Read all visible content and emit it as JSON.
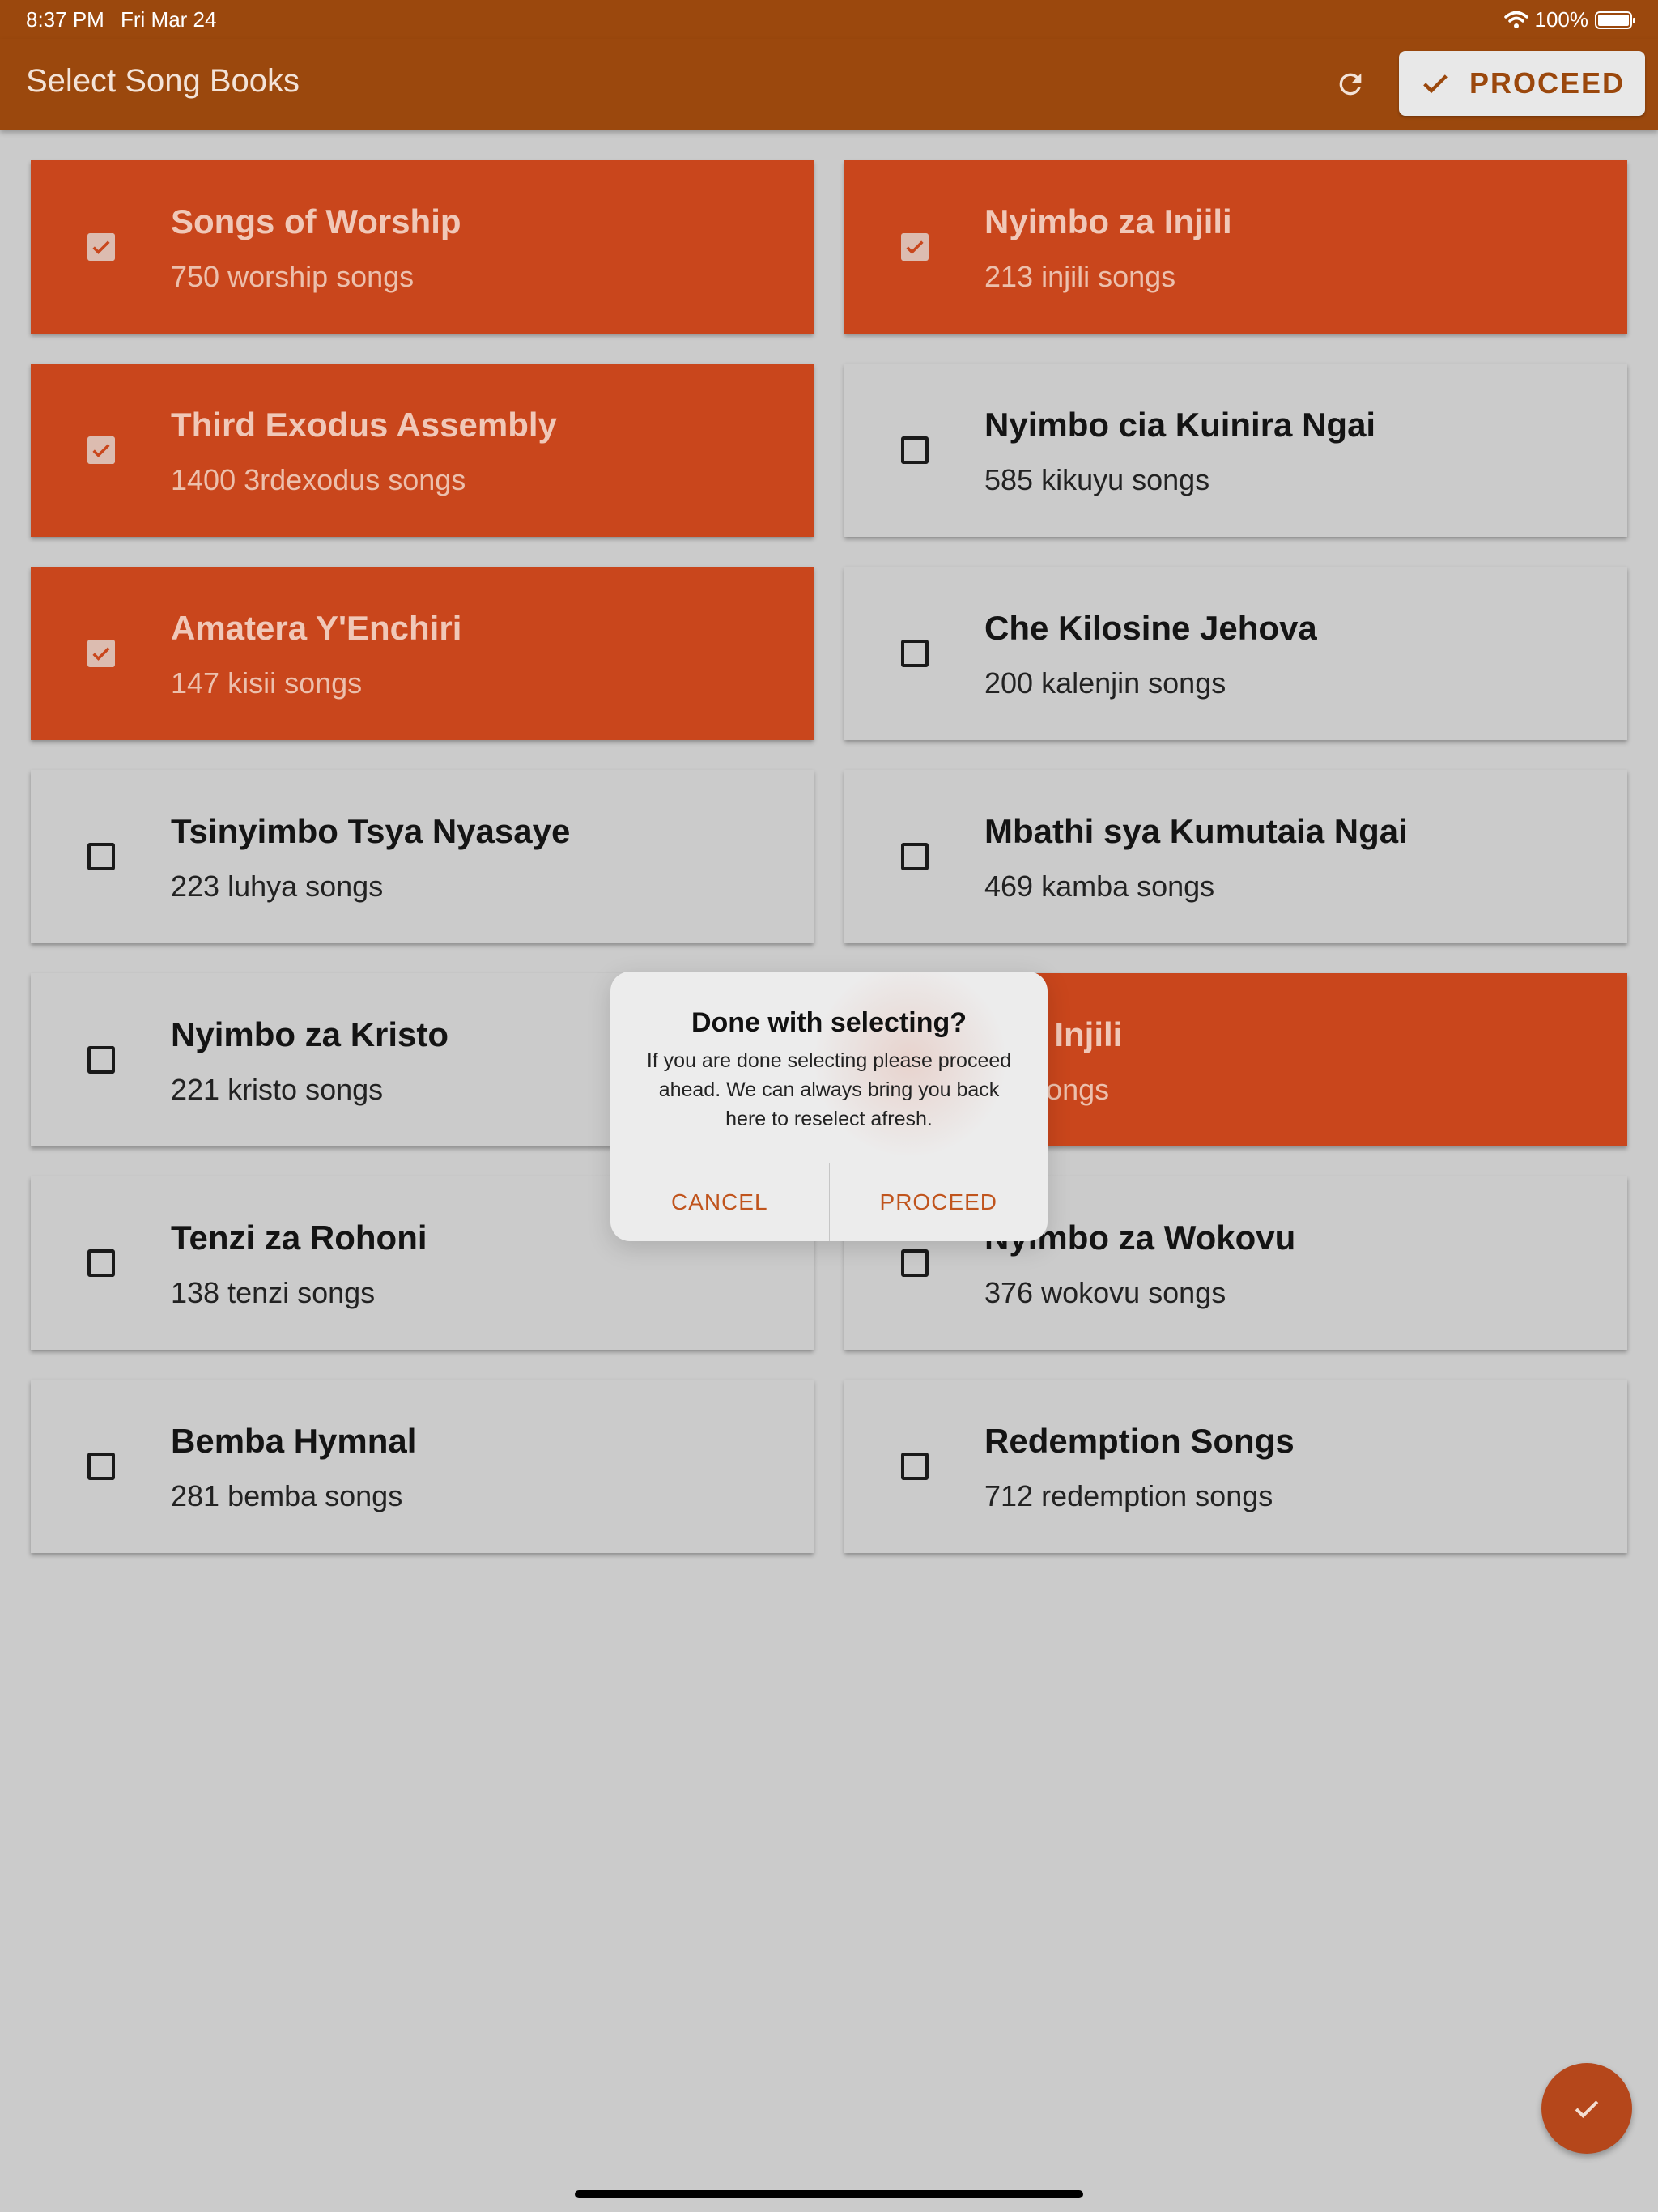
{
  "status_bar": {
    "time": "8:37 PM",
    "date": "Fri Mar 24",
    "battery": "100%"
  },
  "app_bar": {
    "title": "Select Song Books",
    "proceed_label": "PROCEED",
    "refresh_icon": "refresh-icon",
    "check_icon": "check-icon"
  },
  "books": [
    {
      "title": "Songs of Worship",
      "subtitle": "750 worship songs",
      "selected": true
    },
    {
      "title": "Nyimbo za Injili",
      "subtitle": "213 injili songs",
      "selected": true
    },
    {
      "title": "Third Exodus Assembly",
      "subtitle": "1400 3rdexodus songs",
      "selected": true
    },
    {
      "title": "Nyimbo cia Kuinira Ngai",
      "subtitle": "585 kikuyu songs",
      "selected": false
    },
    {
      "title": "Amatera Y'Enchiri",
      "subtitle": "147 kisii songs",
      "selected": true
    },
    {
      "title": "Che Kilosine Jehova",
      "subtitle": "200 kalenjin songs",
      "selected": false
    },
    {
      "title": "Tsinyimbo Tsya Nyasaye",
      "subtitle": "223 luhya songs",
      "selected": false
    },
    {
      "title": "Mbathi sya Kumutaia Ngai",
      "subtitle": "469 kamba songs",
      "selected": false
    },
    {
      "title": "Nyimbo za Kristo",
      "subtitle": "221 kristo songs",
      "selected": false
    },
    {
      "title": "nde Injili",
      "subtitle": "luo songs",
      "selected": true
    },
    {
      "title": "Tenzi za Rohoni",
      "subtitle": "138 tenzi songs",
      "selected": false
    },
    {
      "title": "Nyimbo za Wokovu",
      "subtitle": "376 wokovu songs",
      "selected": false
    },
    {
      "title": "Bemba Hymnal",
      "subtitle": "281 bemba songs",
      "selected": false
    },
    {
      "title": "Redemption Songs",
      "subtitle": "712 redemption songs",
      "selected": false
    }
  ],
  "dialog": {
    "title": "Done with selecting?",
    "message": "If you are done selecting please proceed ahead. We can always bring you back here to reselect afresh.",
    "cancel_label": "CANCEL",
    "proceed_label": "PROCEED"
  },
  "fab": {
    "icon": "check-icon"
  },
  "colors": {
    "primary": "#9b480d",
    "selected_card": "#c9461c",
    "accent": "#c0541d",
    "background": "#cbcbcb"
  }
}
